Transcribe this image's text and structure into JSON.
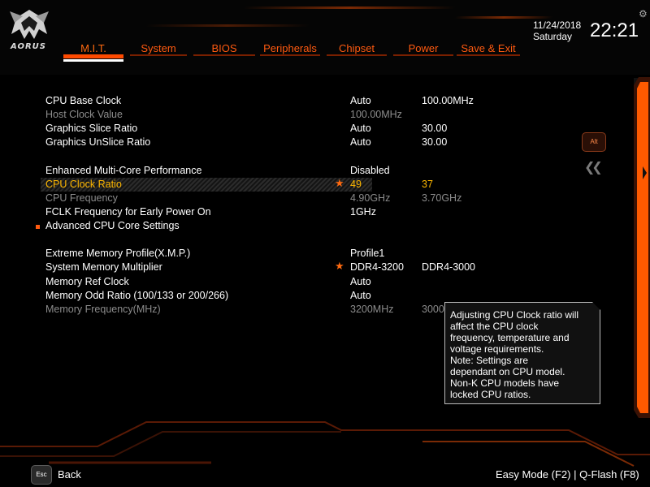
{
  "brand": {
    "logo_text": "AORUS"
  },
  "header": {
    "date": "11/24/2018",
    "day": "Saturday",
    "time": "22:21",
    "tabs": [
      {
        "label": "M.I.T.",
        "active": true
      },
      {
        "label": "System"
      },
      {
        "label": "BIOS"
      },
      {
        "label": "Peripherals"
      },
      {
        "label": "Chipset"
      },
      {
        "label": "Power"
      },
      {
        "label": "Save & Exit"
      }
    ]
  },
  "settings": {
    "cpu_base_clock": {
      "label": "CPU Base Clock",
      "value": "Auto",
      "current": "100.00MHz"
    },
    "host_clock_value": {
      "label": "Host Clock Value",
      "value": "100.00MHz"
    },
    "graphics_slice_ratio": {
      "label": "Graphics Slice Ratio",
      "value": "Auto",
      "current": "30.00"
    },
    "graphics_unslice_ratio": {
      "label": "Graphics UnSlice Ratio",
      "value": "Auto",
      "current": "30.00"
    },
    "enhanced_mce": {
      "label": "Enhanced Multi-Core Performance",
      "value": "Disabled"
    },
    "cpu_clock_ratio": {
      "label": "CPU Clock Ratio",
      "value": "49",
      "current": "37"
    },
    "cpu_frequency": {
      "label": "CPU Frequency",
      "value": "4.90GHz",
      "current": "3.70GHz"
    },
    "fclk_frequency": {
      "label": "FCLK Frequency for Early Power On",
      "value": "1GHz"
    },
    "advanced_cpu_core": {
      "label": "Advanced CPU Core Settings"
    },
    "xmp": {
      "label": "Extreme Memory Profile(X.M.P.)",
      "value": "Profile1"
    },
    "system_memory_multiplier": {
      "label": "System Memory Multiplier",
      "value": "DDR4-3200",
      "current": "DDR4-3000"
    },
    "memory_ref_clock": {
      "label": "Memory Ref Clock",
      "value": "Auto"
    },
    "memory_odd_ratio": {
      "label": "Memory Odd Ratio (100/133 or 200/266)",
      "value": "Auto"
    },
    "memory_frequency": {
      "label": "Memory Frequency(MHz)",
      "value": "3200MHz",
      "current": "3000"
    }
  },
  "help": {
    "text": "Adjusting CPU Clock ratio will\naffect the CPU clock\nfrequency, temperature and\nvoltage requirements.\nNote: Settings are\ndependant  on  CPU model.\nNon-K CPU models have\nlocked CPU ratios."
  },
  "side": {
    "alt_label": "Alt",
    "collapse_icon": "double-chevron-left"
  },
  "footer": {
    "esc_label": "Esc",
    "back_label": "Back",
    "easy_mode": "Easy Mode (F2)  |  Q-Flash (F8)"
  },
  "colors": {
    "accent": "#ff5a10",
    "highlight": "#ffb800",
    "dim_text": "#8c8c8c",
    "background": "#000000"
  }
}
